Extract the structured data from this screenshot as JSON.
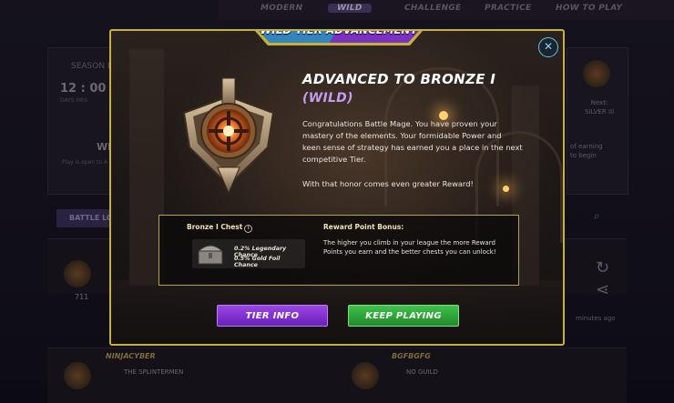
{
  "nav_tabs": [
    {
      "label": "MODERN",
      "active": false
    },
    {
      "label": "WILD",
      "active": true
    },
    {
      "label": "CHALLENGE",
      "active": false
    },
    {
      "label": "PRACTICE",
      "active": false
    },
    {
      "label": "HOW TO PLAY",
      "active": false
    }
  ],
  "background": {
    "season_label": "SEASON E",
    "timer": "12 : 00 :",
    "timer_units": "DAYS     HRS",
    "wild_heading": "WI",
    "play_text": "Play is open to A",
    "battle_log_button": "BATTLE LO",
    "next_label": "Next:",
    "next_tier": "SILVER III",
    "earning_text": "of earning",
    "begin_text": "to begin",
    "rating": "711",
    "player1_name": "NINJACYBER",
    "player1_guild": "THE SPLINTERMEN",
    "player2_name": "BGFBGFG",
    "player2_guild": "NO GUILD",
    "minutes_ago": "minutes ago"
  },
  "modal": {
    "banner_title": "WILD TIER ADVANCEMENT",
    "heading": "ADVANCED TO BRONZE I",
    "subheading": "(WILD)",
    "paragraph_lines_1": [
      "Congratulations Battle Mage. You have proven your",
      "mastery of the elements. Your formidable Power and",
      "keen sense of strategy has earned you a place in the next",
      "competitive Tier."
    ],
    "paragraph_2": "With that honor comes even greater Reward!",
    "reward": {
      "chest_title": "Bronze I Chest",
      "legendary_chance": "0.2% Legendary Chance",
      "gold_foil_chance": "0.5% Gold Foil Chance",
      "bonus_title": "Reward Point Bonus:",
      "bonus_lines": [
        "The higher you climb in your league the more Reward",
        "Points you earn and the better chests you can unlock!"
      ]
    },
    "tier_info_button": "TIER INFO",
    "keep_playing_button": "KEEP PLAYING",
    "close_symbol": "✕"
  },
  "colors": {
    "modal_border": "#c7b13a",
    "subheading": "#c69cf0",
    "tier_button": "#7d2fd0",
    "keep_button": "#2aa536",
    "close_accent": "#5ec8e6"
  }
}
